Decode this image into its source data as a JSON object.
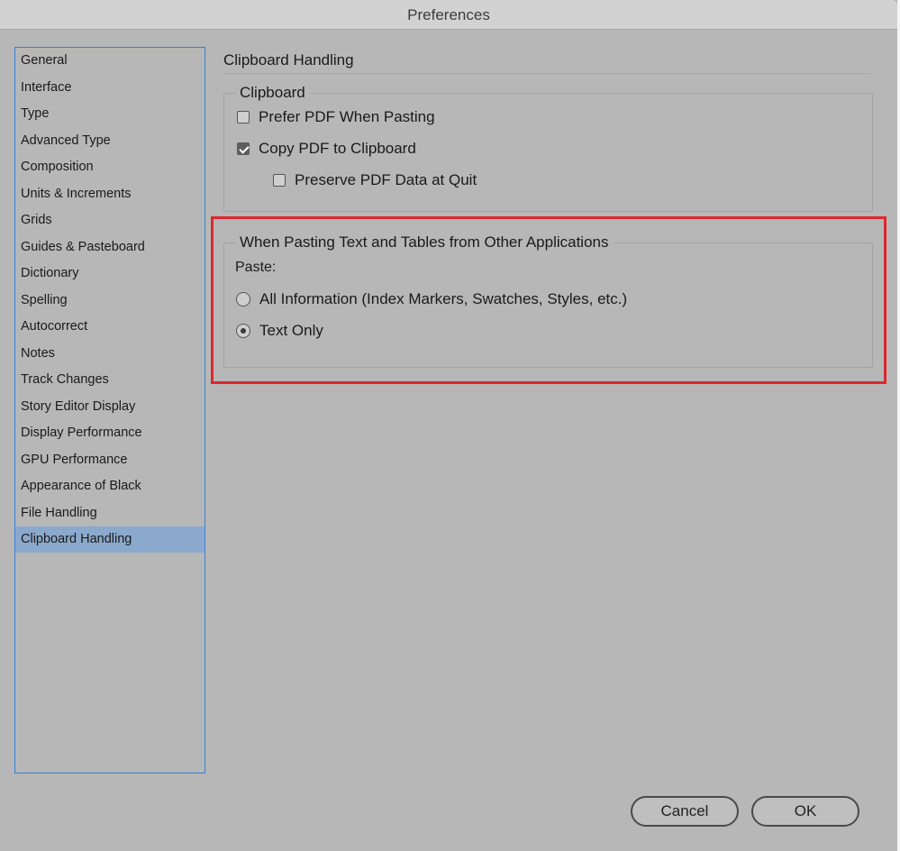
{
  "window": {
    "title": "Preferences"
  },
  "sidebar": {
    "items": [
      {
        "label": "General"
      },
      {
        "label": "Interface"
      },
      {
        "label": "Type"
      },
      {
        "label": "Advanced Type"
      },
      {
        "label": "Composition"
      },
      {
        "label": "Units & Increments"
      },
      {
        "label": "Grids"
      },
      {
        "label": "Guides & Pasteboard"
      },
      {
        "label": "Dictionary"
      },
      {
        "label": "Spelling"
      },
      {
        "label": "Autocorrect"
      },
      {
        "label": "Notes"
      },
      {
        "label": "Track Changes"
      },
      {
        "label": "Story Editor Display"
      },
      {
        "label": "Display Performance"
      },
      {
        "label": "GPU Performance"
      },
      {
        "label": "Appearance of Black"
      },
      {
        "label": "File Handling"
      },
      {
        "label": "Clipboard Handling"
      }
    ],
    "selected": "Clipboard Handling"
  },
  "main": {
    "section_title": "Clipboard Handling",
    "clipboard_group": {
      "legend": "Clipboard",
      "prefer_pdf": {
        "label": "Prefer PDF When Pasting",
        "checked": false
      },
      "copy_pdf": {
        "label": "Copy PDF to Clipboard",
        "checked": true
      },
      "preserve_pdf": {
        "label": "Preserve PDF Data at Quit",
        "checked": false
      }
    },
    "pasting_group": {
      "legend": "When Pasting Text and Tables from Other Applications",
      "paste_label": "Paste:",
      "all_information": {
        "label": "All Information (Index Markers, Swatches, Styles, etc.)",
        "selected": false
      },
      "text_only": {
        "label": "Text Only",
        "selected": true
      }
    }
  },
  "footer": {
    "cancel_label": "Cancel",
    "ok_label": "OK"
  },
  "colors": {
    "highlight": "#e0262d",
    "selection": "#8ba9cc",
    "sidebar_border": "#3a7fd6"
  }
}
